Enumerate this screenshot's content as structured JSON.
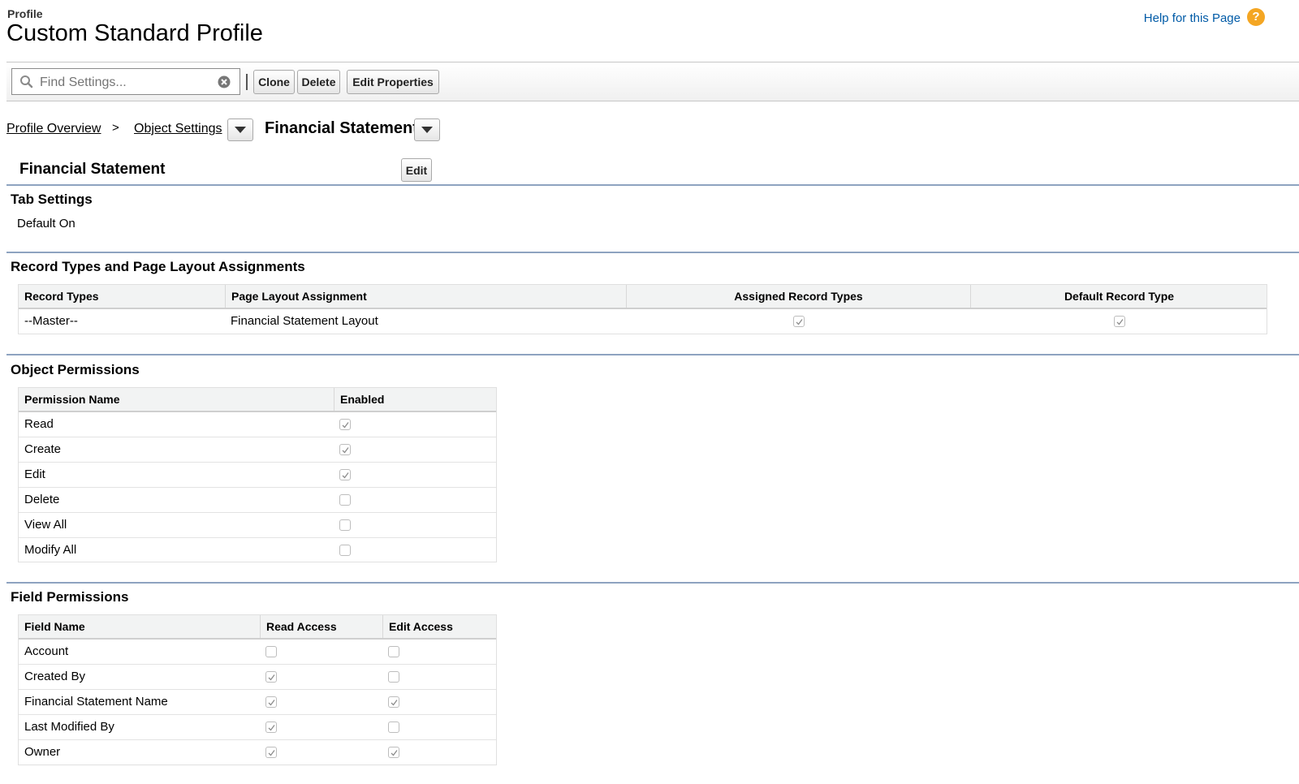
{
  "header": {
    "eyebrow": "Profile",
    "title": "Custom Standard Profile",
    "help_link": "Help for this Page"
  },
  "toolbar": {
    "search_placeholder": "Find Settings...",
    "clone_label": "Clone",
    "delete_label": "Delete",
    "edit_properties_label": "Edit Properties"
  },
  "breadcrumb": {
    "profile_overview": "Profile Overview",
    "separator": ">",
    "object_settings": "Object Settings",
    "current": "Financial Statement"
  },
  "object_header": {
    "title": "Financial Statement",
    "edit_label": "Edit"
  },
  "tab_settings": {
    "title": "Tab Settings",
    "value": "Default On"
  },
  "record_types": {
    "title": "Record Types and Page Layout Assignments",
    "columns": [
      "Record Types",
      "Page Layout Assignment",
      "Assigned Record Types",
      "Default Record Type"
    ],
    "rows": [
      {
        "record_type": "--Master--",
        "layout": "Financial Statement Layout",
        "assigned": true,
        "default": true
      }
    ]
  },
  "object_permissions": {
    "title": "Object Permissions",
    "columns": [
      "Permission Name",
      "Enabled"
    ],
    "rows": [
      {
        "name": "Read",
        "enabled": true
      },
      {
        "name": "Create",
        "enabled": true
      },
      {
        "name": "Edit",
        "enabled": true
      },
      {
        "name": "Delete",
        "enabled": false
      },
      {
        "name": "View All",
        "enabled": false
      },
      {
        "name": "Modify All",
        "enabled": false
      }
    ]
  },
  "field_permissions": {
    "title": "Field Permissions",
    "columns": [
      "Field Name",
      "Read Access",
      "Edit Access"
    ],
    "rows": [
      {
        "name": "Account",
        "read": false,
        "edit": false
      },
      {
        "name": "Created By",
        "read": true,
        "edit": false
      },
      {
        "name": "Financial Statement Name",
        "read": true,
        "edit": true
      },
      {
        "name": "Last Modified By",
        "read": true,
        "edit": false
      },
      {
        "name": "Owner",
        "read": true,
        "edit": true
      }
    ]
  },
  "colors": {
    "help_link": "#015ba7",
    "help_icon": "#f4a623",
    "section_rule": "#8ea3c0",
    "table_header_bg": "#f2f3f3"
  },
  "icons": {
    "search": "search-icon",
    "clear": "clear-icon",
    "help": "help-icon",
    "dropdown": "chevron-down-icon",
    "checkmark": "checkmark-icon"
  }
}
